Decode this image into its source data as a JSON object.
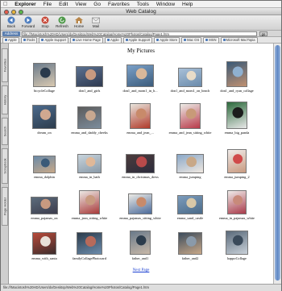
{
  "menubar": {
    "apple": "",
    "items": [
      "Explorer",
      "File",
      "Edit",
      "View",
      "Go",
      "Favorites",
      "Tools",
      "Window",
      "Help"
    ]
  },
  "window": {
    "title": "Web Catalog"
  },
  "toolbar": {
    "buttons": [
      {
        "label": "Back",
        "icon": "back-arrow-icon"
      },
      {
        "label": "Forward",
        "icon": "forward-arrow-icon"
      },
      {
        "label": "Stop",
        "icon": "stop-icon"
      },
      {
        "label": "Refresh",
        "icon": "refresh-icon"
      },
      {
        "label": "Home",
        "icon": "home-icon"
      },
      {
        "label": "Mail",
        "icon": "mail-icon"
      }
    ]
  },
  "address": {
    "label": "Address",
    "url": "file:///Macintosh%20HD/Users/dx/Desktop/Web%20Catalog/Home%20Photos/Catalog/Page1.htm",
    "go_label": "go"
  },
  "favorites": [
    "Apple",
    "iTools",
    "Apple Support",
    "Live Home Page",
    "Apple",
    "Apple Support",
    "Apple Store",
    "Mac OS",
    "MSN",
    "Microsoft MacTopia"
  ],
  "sidebar": {
    "tabs": [
      "Favorites",
      "History",
      "Search",
      "Scrapbook",
      "Page Holder"
    ]
  },
  "page": {
    "title": "My Pictures",
    "next_link": "Next Page",
    "rows": [
      {
        "items": [
          {
            "caption": "bicycleCollage",
            "colors": [
              "#6c7c8c",
              "#2a3a4c",
              "#d8c8b0"
            ]
          },
          {
            "caption": "don1_and_girls",
            "colors": [
              "#5a7090",
              "#c89a80",
              "#2f3a50"
            ]
          },
          {
            "caption": "don1_and_mom1_in_h...",
            "colors": [
              "#7aa0c8",
              "#d9b89a",
              "#3c5c7c"
            ]
          },
          {
            "caption": "don1_and_mom1_on_beach",
            "colors": [
              "#a8c0d8",
              "#e8dcc8",
              "#6b8bab"
            ]
          },
          {
            "caption": "don1_and_ryan_collage",
            "colors": [
              "#3a5a78",
              "#8fb0d0",
              "#c09070"
            ]
          }
        ]
      },
      {
        "items": [
          {
            "caption": "dream_on",
            "colors": [
              "#4c6a8c",
              "#d0a890",
              "#2c3c4c"
            ]
          },
          {
            "caption": "emma_and_daddy_cheeks",
            "colors": [
              "#5c5c5c",
              "#c8a890",
              "#7c8c9c"
            ]
          },
          {
            "caption": "emma_and_jean_...",
            "colors": [
              "#e8e4dc",
              "#c88a6a",
              "#b03a2a"
            ]
          },
          {
            "caption": "emma_and_jean_sitting_white",
            "colors": [
              "#ecebe6",
              "#c89a78",
              "#b83a4a"
            ]
          },
          {
            "caption": "emma_big_panda",
            "colors": [
              "#2c6a3c",
              "#1c1c1c",
              "#e8e8e8"
            ]
          }
        ]
      },
      {
        "items": [
          {
            "caption": "emma_dolphin",
            "colors": [
              "#6a8aa8",
              "#3a5a78",
              "#c8a888"
            ]
          },
          {
            "caption": "emma_in_bath",
            "colors": [
              "#c8d4dc",
              "#e0b898",
              "#8a9aa8"
            ]
          },
          {
            "caption": "emma_in_christmas_dress",
            "colors": [
              "#4c3c3c",
              "#b84a4a",
              "#2c2c3c"
            ]
          },
          {
            "caption": "emma_jumping",
            "colors": [
              "#8aa8c8",
              "#c8a888",
              "#f0e8e0"
            ]
          },
          {
            "caption": "emma_jumping_2",
            "colors": [
              "#f0ecea",
              "#d04a4a",
              "#c89a80"
            ]
          }
        ]
      },
      {
        "items": [
          {
            "caption": "emma_pajamas_on",
            "colors": [
              "#5c6c7c",
              "#c89a80",
              "#3c3c4c"
            ]
          },
          {
            "caption": "emma_jean_sitting_white",
            "colors": [
              "#ece8e4",
              "#c89a80",
              "#a83a3a"
            ]
          },
          {
            "caption": "emma_pajamas_sitting_white",
            "colors": [
              "#ecebe6",
              "#c88a6a",
              "#4a6a9a"
            ]
          },
          {
            "caption": "emma_sand_castle",
            "colors": [
              "#7c9cbc",
              "#d8c8a8",
              "#4a6a88"
            ]
          },
          {
            "caption": "emma_in_pajamas_white",
            "colors": [
              "#f0ecea",
              "#c88a7a",
              "#a83a4a"
            ]
          }
        ]
      },
      {
        "items": [
          {
            "caption": "emma_with_santa",
            "colors": [
              "#b84a3a",
              "#e8e0d8",
              "#3c2c2c"
            ]
          },
          {
            "caption": "familyCollagePhotocard",
            "colors": [
              "#2c3c4c",
              "#b86a5a",
              "#6c8cac"
            ]
          },
          {
            "caption": "father_and1",
            "colors": [
              "#6a7a8a",
              "#2c3c4c",
              "#c8b8a8"
            ]
          },
          {
            "caption": "father_and2",
            "colors": [
              "#3c4c5c",
              "#8a9aaa",
              "#c8a888"
            ]
          },
          {
            "caption": "happoCollage",
            "colors": [
              "#5a6a7a",
              "#3a4a5a",
              "#c8d0d8"
            ]
          }
        ]
      }
    ]
  }
}
